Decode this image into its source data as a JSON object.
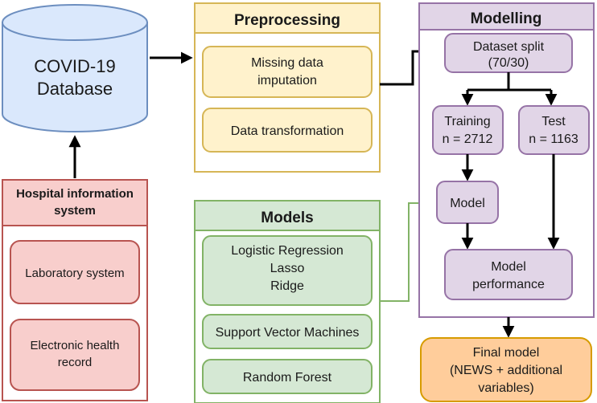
{
  "diagram": {
    "title_hidden": "",
    "database": {
      "label_line1": "COVID-19",
      "label_line2": "Database",
      "fill": "#dae8fc",
      "stroke": "#6c8ebf"
    },
    "hospital_panel": {
      "header": "Hospital information",
      "header_line2": "system",
      "fill": "#f8cecc",
      "stroke": "#b85450",
      "items": [
        {
          "label": "Laboratory system"
        },
        {
          "label": "Electronic health",
          "label_line2": "record"
        }
      ]
    },
    "preprocessing_panel": {
      "header": "Preprocessing",
      "fill": "#fff2cc",
      "stroke": "#d6b656",
      "items": [
        {
          "label": "Missing data",
          "label_line2": "imputation"
        },
        {
          "label": "Data transformation"
        }
      ]
    },
    "models_panel": {
      "header": "Models",
      "fill": "#d5e8d4",
      "stroke": "#82b366",
      "items": [
        {
          "label": "Logistic Regression",
          "label_line2": "Lasso",
          "label_line3": "Ridge"
        },
        {
          "label": "Support Vector Machines"
        },
        {
          "label": "Random Forest"
        }
      ]
    },
    "modelling_panel": {
      "header": "Modelling",
      "fill": "#e1d5e7",
      "stroke": "#9673a6",
      "nodes": {
        "dataset_split": {
          "line1": "Dataset split",
          "line2": "(70/30)"
        },
        "training": {
          "line1": "Training",
          "line2": "n = 2712"
        },
        "test": {
          "line1": "Test",
          "line2": "n = 1163"
        },
        "model": {
          "line1": "Model"
        },
        "model_performance": {
          "line1": "Model",
          "line2": "performance"
        }
      }
    },
    "final_model": {
      "line1": "Final model",
      "line2": "(NEWS + additional",
      "line3": "variables)",
      "fill": "#ffcd9b",
      "stroke": "#d79b00"
    },
    "connector_colors": {
      "default": "#000000",
      "models_to_model": "#82b366"
    }
  }
}
